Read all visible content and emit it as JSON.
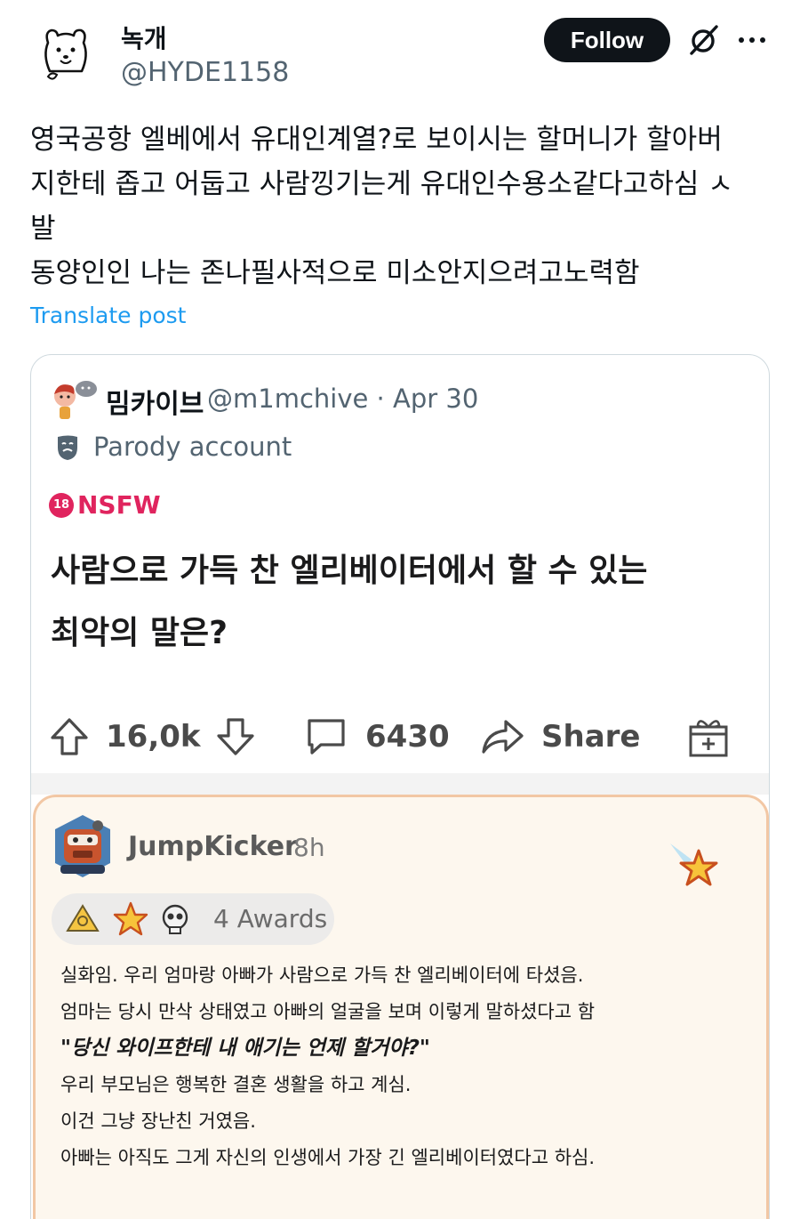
{
  "author": {
    "display_name": "녹개",
    "handle": "@HYDE1158",
    "avatar_icon": "bear-doodle-avatar"
  },
  "header": {
    "follow_label": "Follow",
    "grok_icon": "slash-circle-icon",
    "more_icon": "more-dots-icon"
  },
  "tweet": {
    "lines": [
      "영국공항 엘베에서 유대인계열?로 보이시는 할머니가 할아버",
      "지한테 좁고 어둡고 사람낑기는게 유대인수용소같다고하심 ㅅ",
      "발",
      "동양인인 나는 존나필사적으로 미소안지으려고노력함"
    ],
    "translate_label": "Translate post"
  },
  "quote": {
    "display_name": "밈카이브",
    "handle_date": "@m1mchive · Apr 30",
    "parody_label": "Parody account",
    "reddit": {
      "nsfw_badge": "18",
      "nsfw_label": "NSFW",
      "title_lines": [
        "사람으로 가득 찬 엘리베이터에서 할 수 있는",
        "최악의 말은?"
      ],
      "upvotes": "16,0k",
      "comments": "6430",
      "share_label": "Share",
      "comment": {
        "user": "JumpKicker",
        "time": "8h",
        "awards_label": "4 Awards",
        "body": [
          "실화임. 우리 엄마랑 아빠가 사람으로 가득 찬 엘리베이터에 타셨음.",
          "엄마는 당시 만삭 상태였고 아빠의 얼굴을 보며 이렇게 말하셨다고 함",
          "\"당신 와이프한테 내 애기는 언제 할거야?\"",
          "우리 부모님은 행복한 결혼 생활을 하고 계심.",
          "이건 그냥 장난친 거였음.",
          "아빠는 아직도 그게 자신의 인생에서 가장 긴 엘리베이터였다고 하심."
        ]
      }
    }
  },
  "colors": {
    "accent": "#1d9bf0",
    "nsfw": "#e0245e",
    "comment_border": "#f2c7a4"
  }
}
